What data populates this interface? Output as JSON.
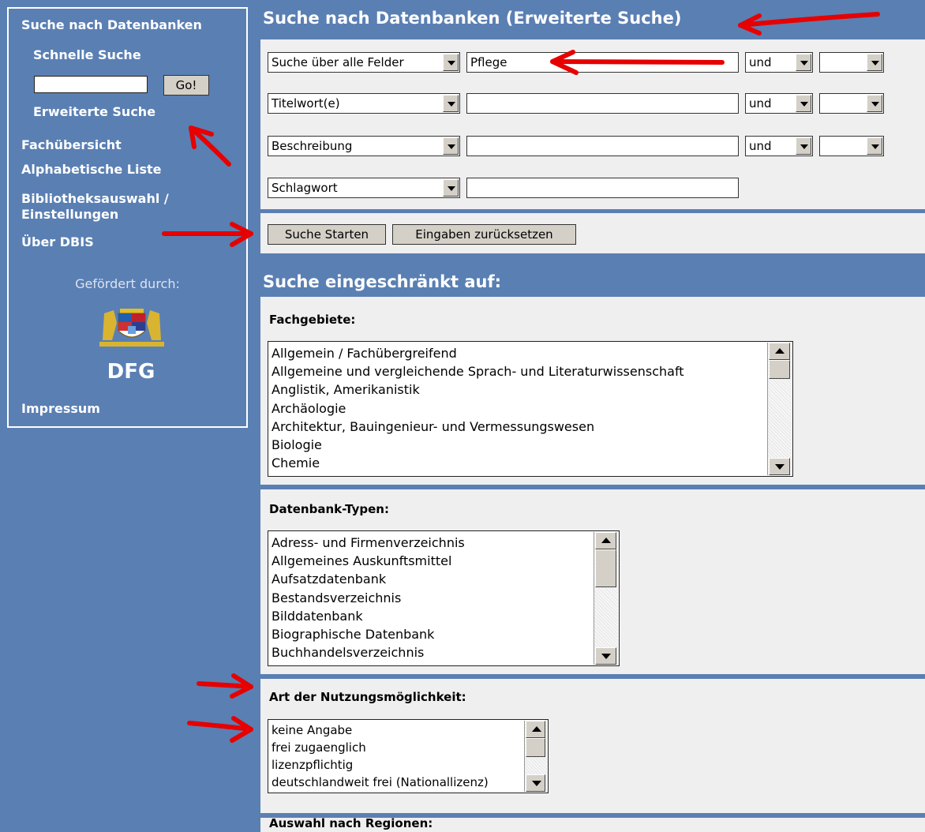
{
  "sidebar": {
    "title": "Suche nach Datenbanken",
    "quick_search_label": "Schnelle Suche",
    "quick_search_value": "",
    "go_label": "Go!",
    "advanced_search_label": "Erweiterte Suche",
    "items": [
      {
        "label": "Fachübersicht"
      },
      {
        "label": "Alphabetische Liste"
      },
      {
        "label": "Bibliotheksauswahl /"
      },
      {
        "label": "Einstellungen"
      },
      {
        "label": "Über DBIS"
      }
    ],
    "funded_by": "Gefördert durch:",
    "dfg_logo": "DFG",
    "impressum": "Impressum"
  },
  "main": {
    "header": "Suche nach Datenbanken (Erweiterte Suche)",
    "rows": [
      {
        "field": "Suche über alle Felder",
        "value": "Pflege",
        "operator": "und",
        "extra": ""
      },
      {
        "field": "Titelwort(e)",
        "value": "",
        "operator": "und",
        "extra": ""
      },
      {
        "field": "Beschreibung",
        "value": "",
        "operator": "und",
        "extra": ""
      },
      {
        "field": "Schlagwort",
        "value": ""
      }
    ],
    "start_label": "Suche Starten",
    "reset_label": "Eingaben zurücksetzen",
    "restricted_header": "Suche eingeschränkt auf:",
    "fachgebiete": {
      "title": "Fachgebiete:",
      "items": [
        "Allgemein / Fachübergreifend",
        "Allgemeine und vergleichende Sprach- und Literaturwissenschaft",
        "Anglistik, Amerikanistik",
        "Archäologie",
        "Architektur, Bauingenieur- und Vermessungswesen",
        "Biologie",
        "Chemie"
      ]
    },
    "typen": {
      "title": "Datenbank-Typen:",
      "items": [
        "Adress- und Firmenverzeichnis",
        "Allgemeines Auskunftsmittel",
        "Aufsatzdatenbank",
        "Bestandsverzeichnis",
        "Bilddatenbank",
        "Biographische Datenbank",
        "Buchhandelsverzeichnis"
      ]
    },
    "nutzung": {
      "title": "Art der Nutzungsmöglichkeit:",
      "items": [
        "keine Angabe",
        "frei zugaenglich",
        "lizenzpflichtig",
        "deutschlandweit frei (Nationallizenz)"
      ]
    },
    "regionen_title": "Auswahl nach Regionen:"
  },
  "colors": {
    "background": "#5a7fb3",
    "panel": "#efefef",
    "annotation": "#e60000"
  }
}
